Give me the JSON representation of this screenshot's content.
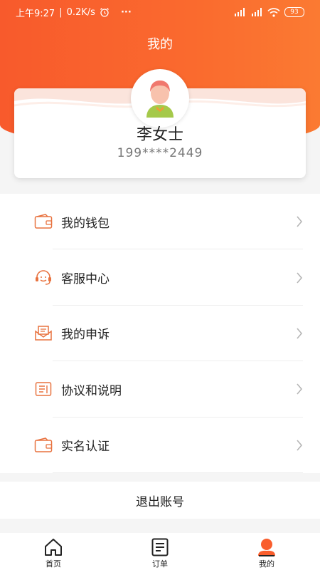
{
  "status_bar": {
    "time": "上午9:27",
    "speed": "0.2K/s",
    "battery": "93"
  },
  "header": {
    "title": "我的"
  },
  "profile": {
    "name": "李女士",
    "phone": "199****2449"
  },
  "menu": {
    "items": [
      {
        "label": "我的钱包",
        "icon": "wallet-icon"
      },
      {
        "label": "客服中心",
        "icon": "headset-icon"
      },
      {
        "label": "我的申诉",
        "icon": "mail-icon"
      },
      {
        "label": "协议和说明",
        "icon": "document-icon"
      },
      {
        "label": "实名认证",
        "icon": "id-card-icon"
      }
    ]
  },
  "logout": {
    "label": "退出账号"
  },
  "tabbar": {
    "items": [
      {
        "label": "首页",
        "icon": "home-icon"
      },
      {
        "label": "订单",
        "icon": "order-list-icon"
      },
      {
        "label": "我的",
        "icon": "profile-icon"
      }
    ]
  },
  "colors": {
    "accent": "#f95e2d",
    "icon_orange": "#e8723f"
  }
}
